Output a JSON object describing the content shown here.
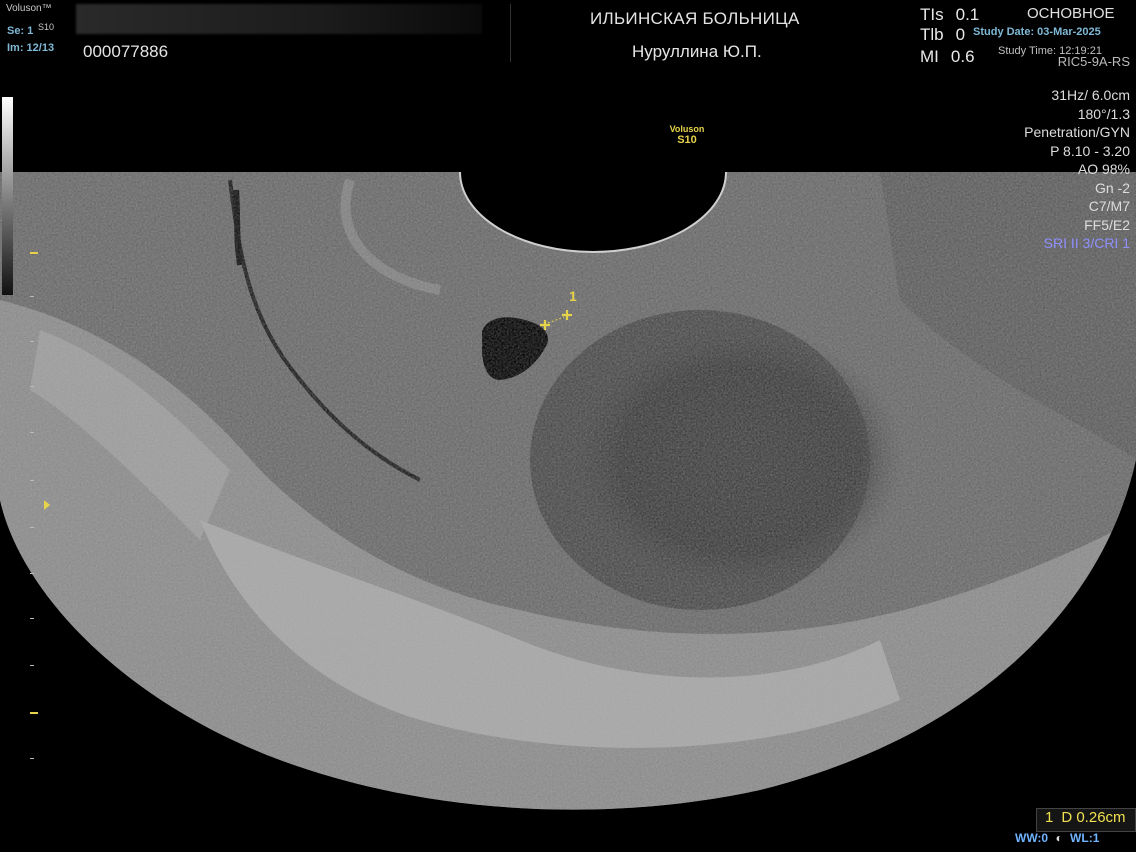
{
  "header": {
    "brand": "Voluson™",
    "brand_model": "S10",
    "series": "Se: 1",
    "image_index": "Im: 12/13",
    "patient_id": "000077886",
    "hospital": "ИЛЬИНСКАЯ БОЛЬНИЦА",
    "operator": "Нуруллина Ю.П.",
    "mode": "ОСНОВНОЕ",
    "study_date": "Study Date: 03-Mar-2025",
    "study_time": "Study Time: 12:19:21",
    "probe": "RIC5-9A-RS"
  },
  "safety": [
    {
      "label": "TIs",
      "value": "0.1"
    },
    {
      "label": "Tlb",
      "value": "0"
    },
    {
      "label": "MI",
      "value": "0.6"
    }
  ],
  "params": [
    {
      "text": "31Hz/ 6.0cm",
      "color": "#dcdcdc"
    },
    {
      "text": "180°/1.3",
      "color": "#dcdcdc"
    },
    {
      "text": "Penetration/GYN",
      "color": "#dcdcdc"
    },
    {
      "text": "P 8.10 - 3.20",
      "color": "#dcdcdc"
    },
    {
      "text": "AO 98%",
      "color": "#dcdcdc"
    },
    {
      "text": "Gn -2",
      "color": "#dcdcdc"
    },
    {
      "text": "C7/M7",
      "color": "#dcdcdc"
    },
    {
      "text": "FF5/E2",
      "color": "#dcdcdc"
    },
    {
      "text": "SRI II 3/CRI 1",
      "color": "#8f8fff"
    }
  ],
  "image_label": {
    "line1": "Voluson",
    "line2": "S10"
  },
  "caliper_label": "1",
  "measurement": {
    "index": "1",
    "text": "D 0.26cm"
  },
  "window": {
    "ww": "WW:0",
    "wl": "WL:1"
  }
}
